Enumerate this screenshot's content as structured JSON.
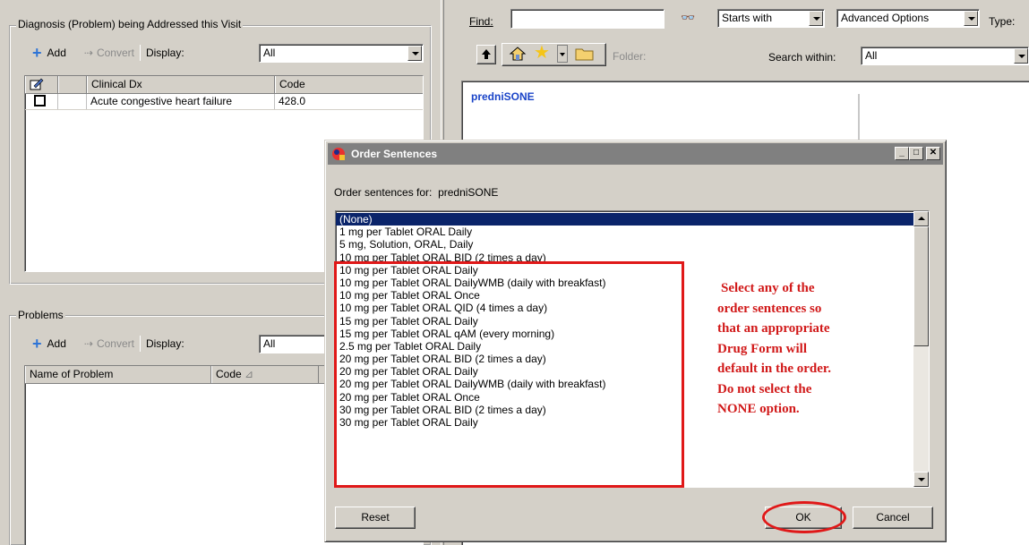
{
  "diagnosis": {
    "legend": "Diagnosis (Problem) being Addressed this Visit",
    "add": "Add",
    "convert": "Convert",
    "display_label": "Display:",
    "display_value": "All",
    "col_clinical": "Clinical Dx",
    "col_code": "Code",
    "rows": [
      {
        "dx": "Acute congestive heart failure",
        "code": "428.0"
      }
    ]
  },
  "problems": {
    "legend": "Problems",
    "add": "Add",
    "convert": "Convert",
    "display_label": "Display:",
    "display_value": "All",
    "col_name": "Name of Problem",
    "col_code": "Code"
  },
  "search": {
    "find_label": "Find:",
    "find_value": "",
    "match_value": "Starts with",
    "advanced": "Advanced Options",
    "type_label": "Type:",
    "folder_label": "Folder:",
    "within_label": "Search within:",
    "within_value": "All",
    "result": "predniSONE"
  },
  "dialog": {
    "title": "Order Sentences",
    "for_label": "Order sentences for:",
    "drug": "predniSONE",
    "items": [
      "(None)",
      "1 mg per Tablet ORAL Daily",
      "5 mg, Solution, ORAL, Daily",
      "10 mg per Tablet ORAL BID (2 times a day)",
      "10 mg per Tablet ORAL Daily",
      "10 mg per Tablet ORAL DailyWMB (daily with breakfast)",
      "10 mg per Tablet ORAL Once",
      "10 mg per Tablet ORAL QID (4 times a day)",
      "15 mg per Tablet ORAL Daily",
      "15 mg per Tablet ORAL qAM (every morning)",
      "2.5 mg per Tablet ORAL Daily",
      "20 mg per Tablet ORAL BID (2 times a day)",
      "20 mg per Tablet ORAL Daily",
      "20 mg per Tablet ORAL DailyWMB (daily with breakfast)",
      "20 mg per Tablet ORAL Once",
      "30 mg per Tablet ORAL BID (2 times a day)",
      "30 mg per Tablet ORAL Daily"
    ],
    "note_lines": [
      "Select any of the",
      "order sentences so",
      "that an appropriate",
      "Drug Form will",
      "default in the order.",
      "Do not select the",
      "NONE option."
    ],
    "reset": "Reset",
    "ok": "OK",
    "cancel": "Cancel"
  },
  "colors": {
    "selection": "#0a246a",
    "annotation": "#d11919",
    "link": "#1a44c8"
  }
}
